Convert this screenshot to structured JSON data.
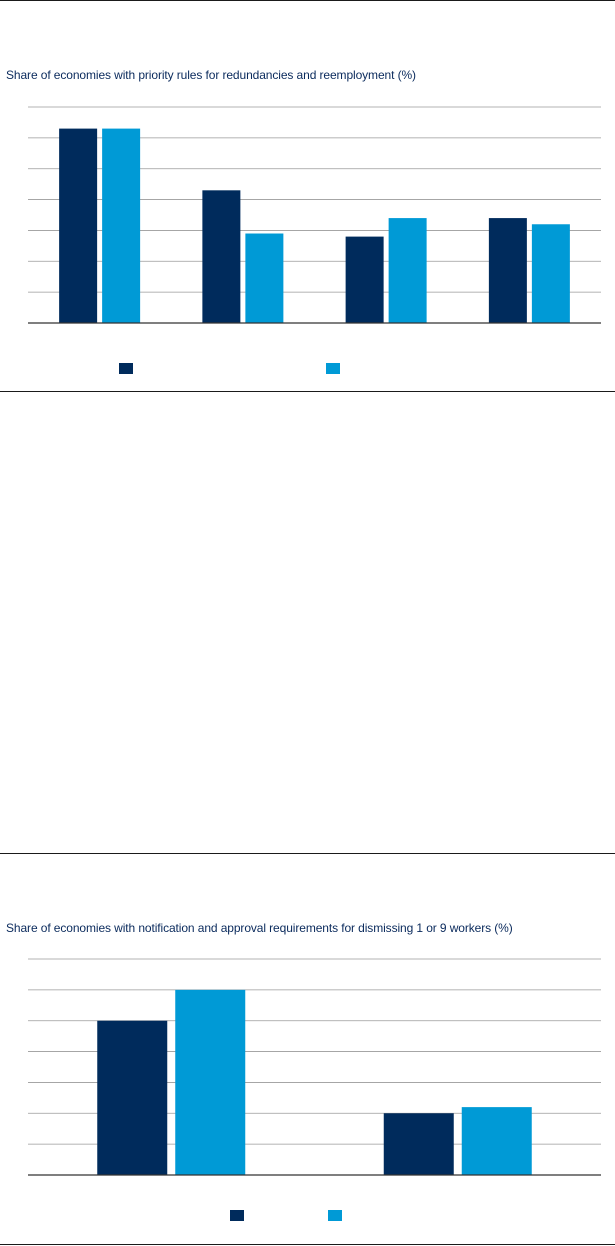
{
  "colors": {
    "dark": "#002b5c",
    "light": "#009ad6",
    "grid": "#9a9a9a",
    "axis": "#333333"
  },
  "panel1": {
    "title": "Share of economies with priority rules for redundancies and reemployment (%)"
  },
  "panel2": {
    "title": "Share of economies with notification and approval requirements for dismissing 1 or 9 workers (%)"
  },
  "chart_data": [
    {
      "type": "bar",
      "title": "Share of economies with priority rules for redundancies and reemployment (%)",
      "categories": [
        "",
        "",
        "",
        ""
      ],
      "series": [
        {
          "color": "#002b5c",
          "values": [
            63,
            43,
            28,
            34
          ]
        },
        {
          "color": "#009ad6",
          "values": [
            63,
            29,
            34,
            32
          ]
        }
      ],
      "ylim": [
        0,
        70
      ],
      "gridlines": 7,
      "grid": true,
      "legend": "bottom"
    },
    {
      "type": "bar",
      "title": "Share of economies with notification and approval requirements for dismissing 1 or 9 workers (%)",
      "categories": [
        "",
        ""
      ],
      "series": [
        {
          "color": "#002b5c",
          "values": [
            50,
            20
          ]
        },
        {
          "color": "#009ad6",
          "values": [
            60,
            22
          ]
        }
      ],
      "ylim": [
        0,
        70
      ],
      "gridlines": 7,
      "grid": true,
      "legend": "bottom"
    }
  ]
}
